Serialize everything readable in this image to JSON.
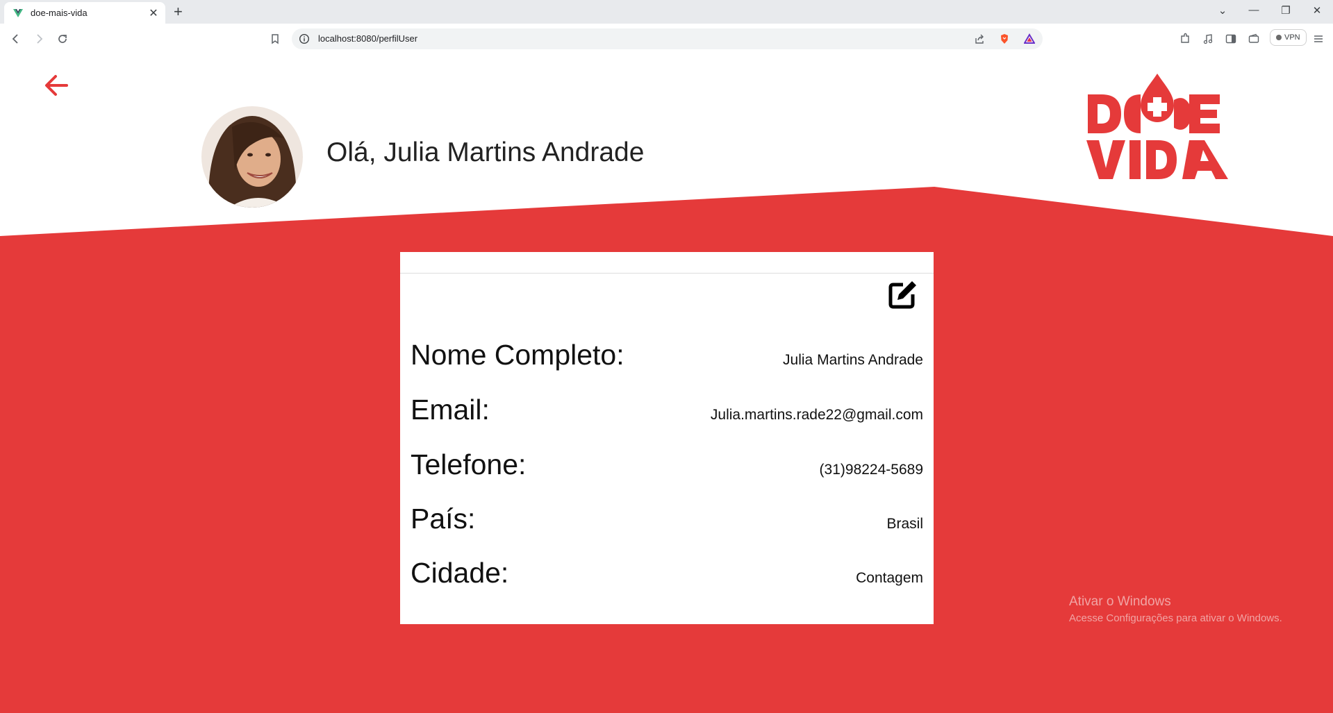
{
  "browser": {
    "tab_title": "doe-mais-vida",
    "tab_close": "✕",
    "new_tab": "+",
    "url": "localhost:8080/perfilUser",
    "vpn_label": "VPN",
    "window_controls": {
      "minimize": "—",
      "restore": "❐",
      "close": "✕",
      "dropdown": "⌄"
    }
  },
  "header": {
    "greeting": "Olá, Julia Martins Andrade",
    "logo_text": "DOE VIDA",
    "back_icon": "arrow-left-icon"
  },
  "profile": {
    "rows": [
      {
        "label": "Nome Completo:",
        "value": "Julia Martins Andrade"
      },
      {
        "label": "Email:",
        "value": "Julia.martins.rade22@gmail.com"
      },
      {
        "label": "Telefone:",
        "value": "(31)98224-5689"
      },
      {
        "label": "País:",
        "value": "Brasil"
      },
      {
        "label": "Cidade:",
        "value": "Contagem"
      }
    ],
    "edit_icon": "edit-icon"
  },
  "watermark": {
    "title": "Ativar o Windows",
    "subtitle": "Acesse Configurações para ativar o Windows."
  },
  "colors": {
    "brand_red": "#e53a3a",
    "text_dark": "#222222",
    "chrome_bg": "#e8eaed"
  }
}
